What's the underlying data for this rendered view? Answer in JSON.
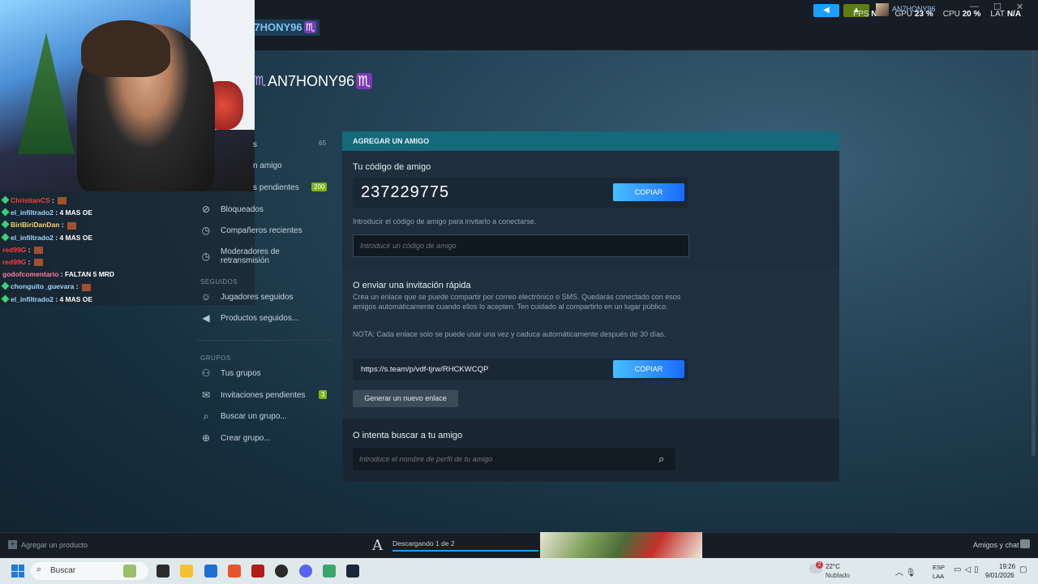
{
  "top": {
    "username": "N7HONY96",
    "zodiac": "♏",
    "stats": {
      "fps_label": "FPS",
      "fps_value": "N/A",
      "gpu_label": "GPU",
      "gpu_value": "23 %",
      "cpu_label": "CPU",
      "cpu_value": "20 %",
      "lat_label": "LAT",
      "lat_value": "N/A"
    },
    "mini_user": "AN7HONY96"
  },
  "chat": [
    {
      "user": "ChristianCS",
      "msg": "",
      "color": "#ff3b3b",
      "emote": true
    },
    {
      "user": "el_infiltrado2",
      "msg": "4 MAS OE",
      "color": "#9ed6ff",
      "emote": false
    },
    {
      "user": "BiriBiriDanDan",
      "msg": "",
      "color": "#ffd36b",
      "emote": true
    },
    {
      "user": "el_infiltrado2",
      "msg": "4 MAS OE",
      "color": "#9ed6ff",
      "emote": false
    },
    {
      "user": "red99G",
      "msg": "",
      "color": "#ff3b3b",
      "emote": true
    },
    {
      "user": "red99G",
      "msg": "",
      "color": "#ff3b3b",
      "emote": true
    },
    {
      "user": "godofcomentario",
      "msg": "FALTAN 5 MRD",
      "color": "#ff7aa2",
      "emote": false
    },
    {
      "user": "chonguito_guevara",
      "msg": "",
      "color": "#9ed6ff",
      "emote": true
    },
    {
      "user": "el_infiltrado2",
      "msg": "4 MAS OE",
      "color": "#9ed6ff",
      "emote": false
    }
  ],
  "header": {
    "name": "AN7HONY96",
    "zodiac": "♏"
  },
  "nav": {
    "item_friends": "s",
    "friends_count": "65",
    "item_add": "n amigo",
    "item_pending": "s pendientes",
    "pending_badge": "200",
    "item_blocked": "Bloqueados",
    "item_recent": "Compañeros recientes",
    "item_mods": "Moderadores de retransmisión",
    "section_follow": "SEGUIDOS",
    "item_players": "Jugadores seguidos",
    "item_products": "Productos seguidos...",
    "section_groups": "GRUPOS",
    "item_groups": "Tus grupos",
    "item_invites": "Invitaciones pendientes",
    "invites_badge": "3",
    "item_search_group": "Buscar un grupo...",
    "item_create_group": "Crear grupo..."
  },
  "panel": {
    "header": "AGREGAR UN AMIGO",
    "code_title": "Tu código de amigo",
    "code_value": "237229775",
    "copy_label": "COPIAR",
    "code_hint": "Introducir el código de amigo para invitarlo a conectarse.",
    "code_placeholder": "Introducir un código de amigo",
    "invite_title": "O enviar una invitación rápida",
    "invite_desc": "Crea un enlace que se puede compartir por correo electrónico o SMS. Quedarás conectado con esos amigos automáticamente cuando ellos lo acepten. Ten cuidado al compartirlo en un lugar público.",
    "invite_note": "NOTA: Cada enlace solo se puede usar una vez y caduca automáticamente después de 30 días.",
    "invite_link": "https://s.team/p/vdf-tjrw/RHCKWCQP",
    "gen_label": "Generar un nuevo enlace",
    "search_title": "O intenta buscar a tu amigo",
    "search_placeholder": "Introduce el nombre de perfil de tu amigo"
  },
  "bottom": {
    "add_product": "Agregar un producto",
    "download": "Descargando 1 de 2",
    "download_progress": 1.0,
    "friends_chat": "Amigos y chat"
  },
  "taskbar": {
    "search": "Buscar",
    "weather_badge": "2",
    "temp": "22°C",
    "condition": "Nublado",
    "lang1": "ESP",
    "lang2": "LAA",
    "time": "19:26",
    "date": "9/01/2026"
  }
}
